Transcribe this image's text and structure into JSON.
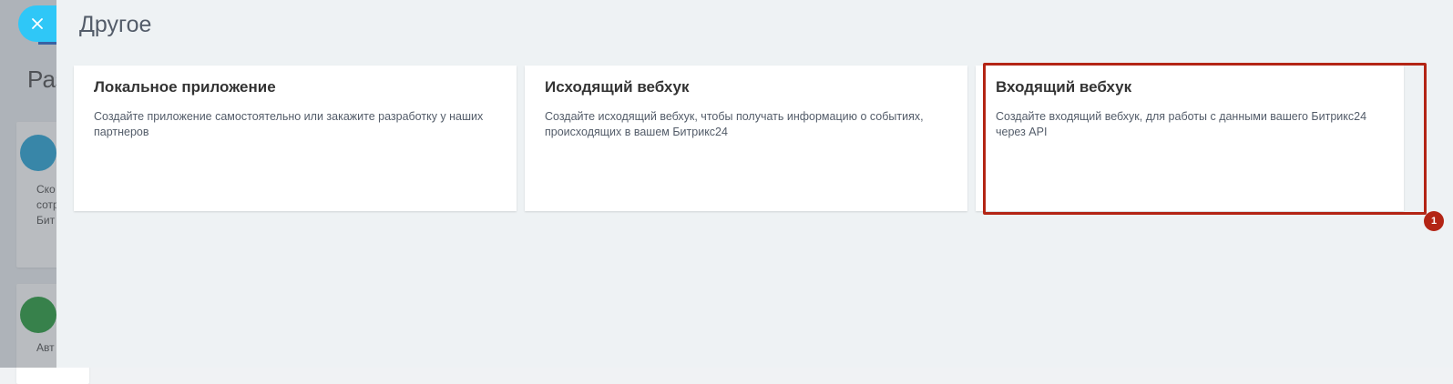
{
  "background": {
    "heading_partial": "Раз",
    "card1_lines": [
      "Ско",
      "сотр",
      "Бит"
    ],
    "card2_lines": [
      "Авт"
    ]
  },
  "panel": {
    "title": "Другое",
    "close_icon": "close-icon",
    "accent_color": "#2fc7f7"
  },
  "cards": [
    {
      "title": "Локальное приложение",
      "description": "Создайте приложение самостоятельно или закажите разработку у наших партнеров"
    },
    {
      "title": "Исходящий вебхук",
      "description": "Создайте исходящий вебхук, чтобы получать информацию о событиях, происходящих в вашем Битрикс24"
    },
    {
      "title": "Входящий вебхук",
      "description": "Создайте входящий вебхук, для работы с данными вашего Битрикс24 через API"
    }
  ],
  "annotation": {
    "badge_label": "1",
    "color": "#b32515"
  }
}
